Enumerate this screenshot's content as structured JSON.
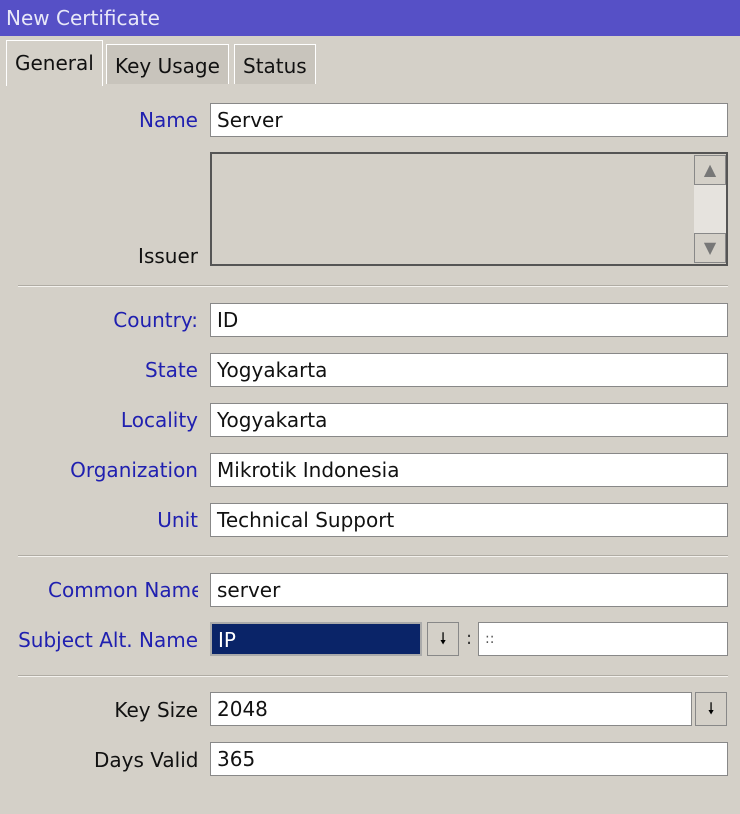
{
  "window": {
    "title": "New Certificate"
  },
  "tabs": [
    {
      "label": "General",
      "active": true
    },
    {
      "label": "Key Usage"
    },
    {
      "label": "Status"
    }
  ],
  "form": {
    "name": {
      "label": "Name",
      "value": "Server"
    },
    "issuer": {
      "label": "Issuer",
      "value": ""
    },
    "country": {
      "label": "Country:",
      "value": "ID"
    },
    "state": {
      "label": "State",
      "value": "Yogyakarta"
    },
    "locality": {
      "label": "Locality",
      "value": "Yogyakarta"
    },
    "organization": {
      "label": "Organization",
      "value": "Mikrotik Indonesia"
    },
    "unit": {
      "label": "Unit",
      "value": "Technical Support"
    },
    "common_name": {
      "label": "Common Name",
      "value": "server"
    },
    "subject_alt_name": {
      "label": "Subject Alt. Name",
      "type": "IP",
      "separator": ":",
      "value": "::"
    },
    "key_size": {
      "label": "Key Size",
      "value": "2048"
    },
    "days_valid": {
      "label": "Days Valid",
      "value": "365"
    }
  },
  "colors": {
    "titlebar": "#5650c6",
    "label_blue": "#2020b0",
    "selection": "#0a2468"
  }
}
